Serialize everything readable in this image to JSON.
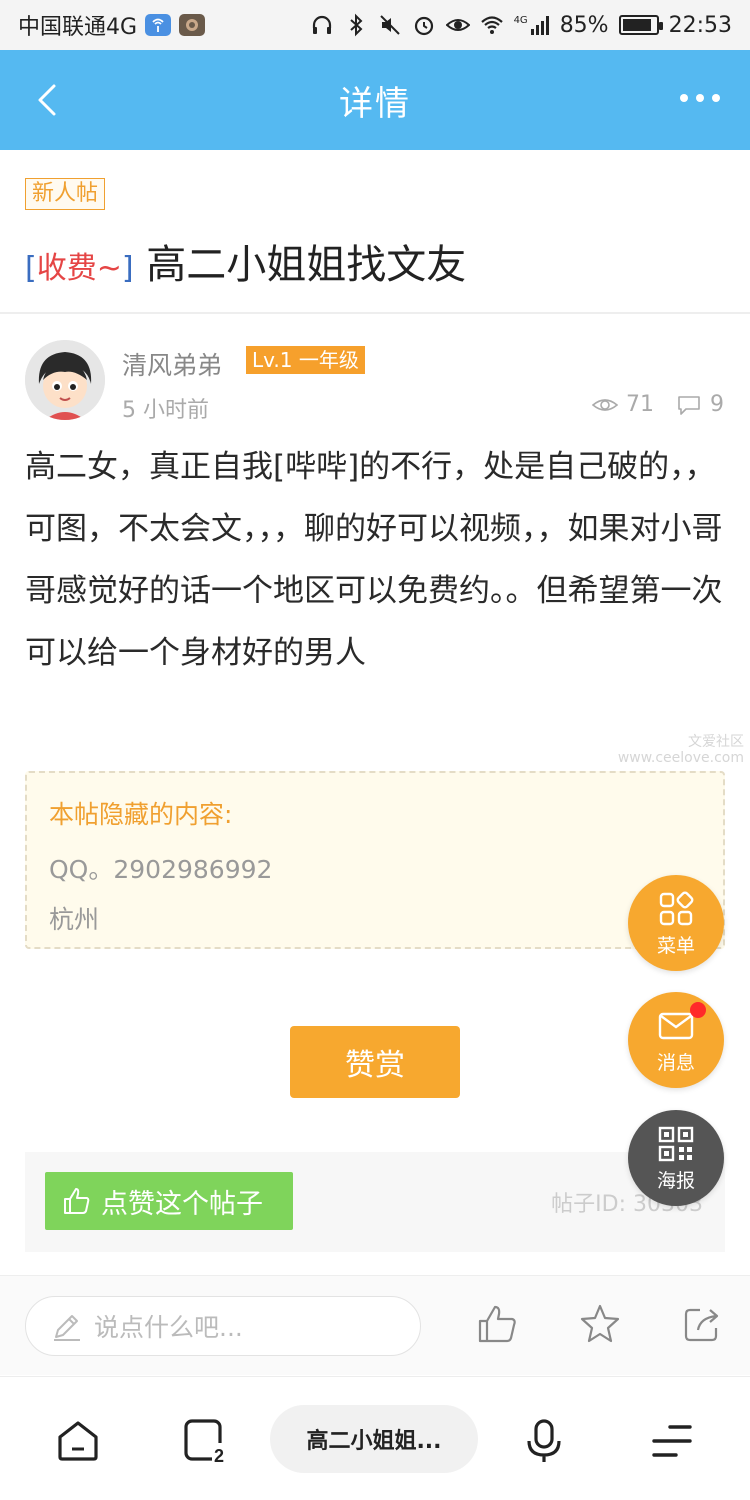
{
  "status_bar": {
    "carrier": "中国联通4G",
    "battery": "85%",
    "time": "22:53",
    "signal_label": "4G"
  },
  "header": {
    "title": "详情"
  },
  "post": {
    "newbie_tag": "新人帖",
    "title_tag_open": "[",
    "title_tag": "收费~",
    "title_tag_close": "]",
    "title": "高二小姐姐找文友",
    "author": {
      "name": "清风弟弟",
      "level": "Lv.1 一年级",
      "time": "5 小时前",
      "views": "71",
      "comments": "9"
    },
    "body": "高二女，真正自我[哔哔]的不行，处是自己破的，，可图，不太会文，，，聊的好可以视频，，如果对小哥哥感觉好的话一个地区可以免费约。。但希望第一次可以给一个身材好的男人",
    "watermark_line1": "文爱社区",
    "watermark_line2": "www.ceelove.com",
    "hidden": {
      "title": "本帖隐藏的内容:",
      "line1": "QQ。2902986992",
      "line2": "杭州"
    },
    "reward_label": "赞赏",
    "like_label": "点赞这个帖子",
    "post_id": "帖子ID: 30303"
  },
  "comment_bar": {
    "placeholder": "说点什么吧..."
  },
  "fabs": {
    "menu": "菜单",
    "message": "消息",
    "poster": "海报"
  },
  "bottom_nav": {
    "tab_count": "2",
    "current_page": "高二小姐姐..."
  },
  "colors": {
    "header_blue": "#55b9f1",
    "accent_orange": "#f7a82f",
    "like_green": "#7fd45b",
    "tag_red": "#e54545",
    "tag_blue": "#3a6dc0"
  }
}
